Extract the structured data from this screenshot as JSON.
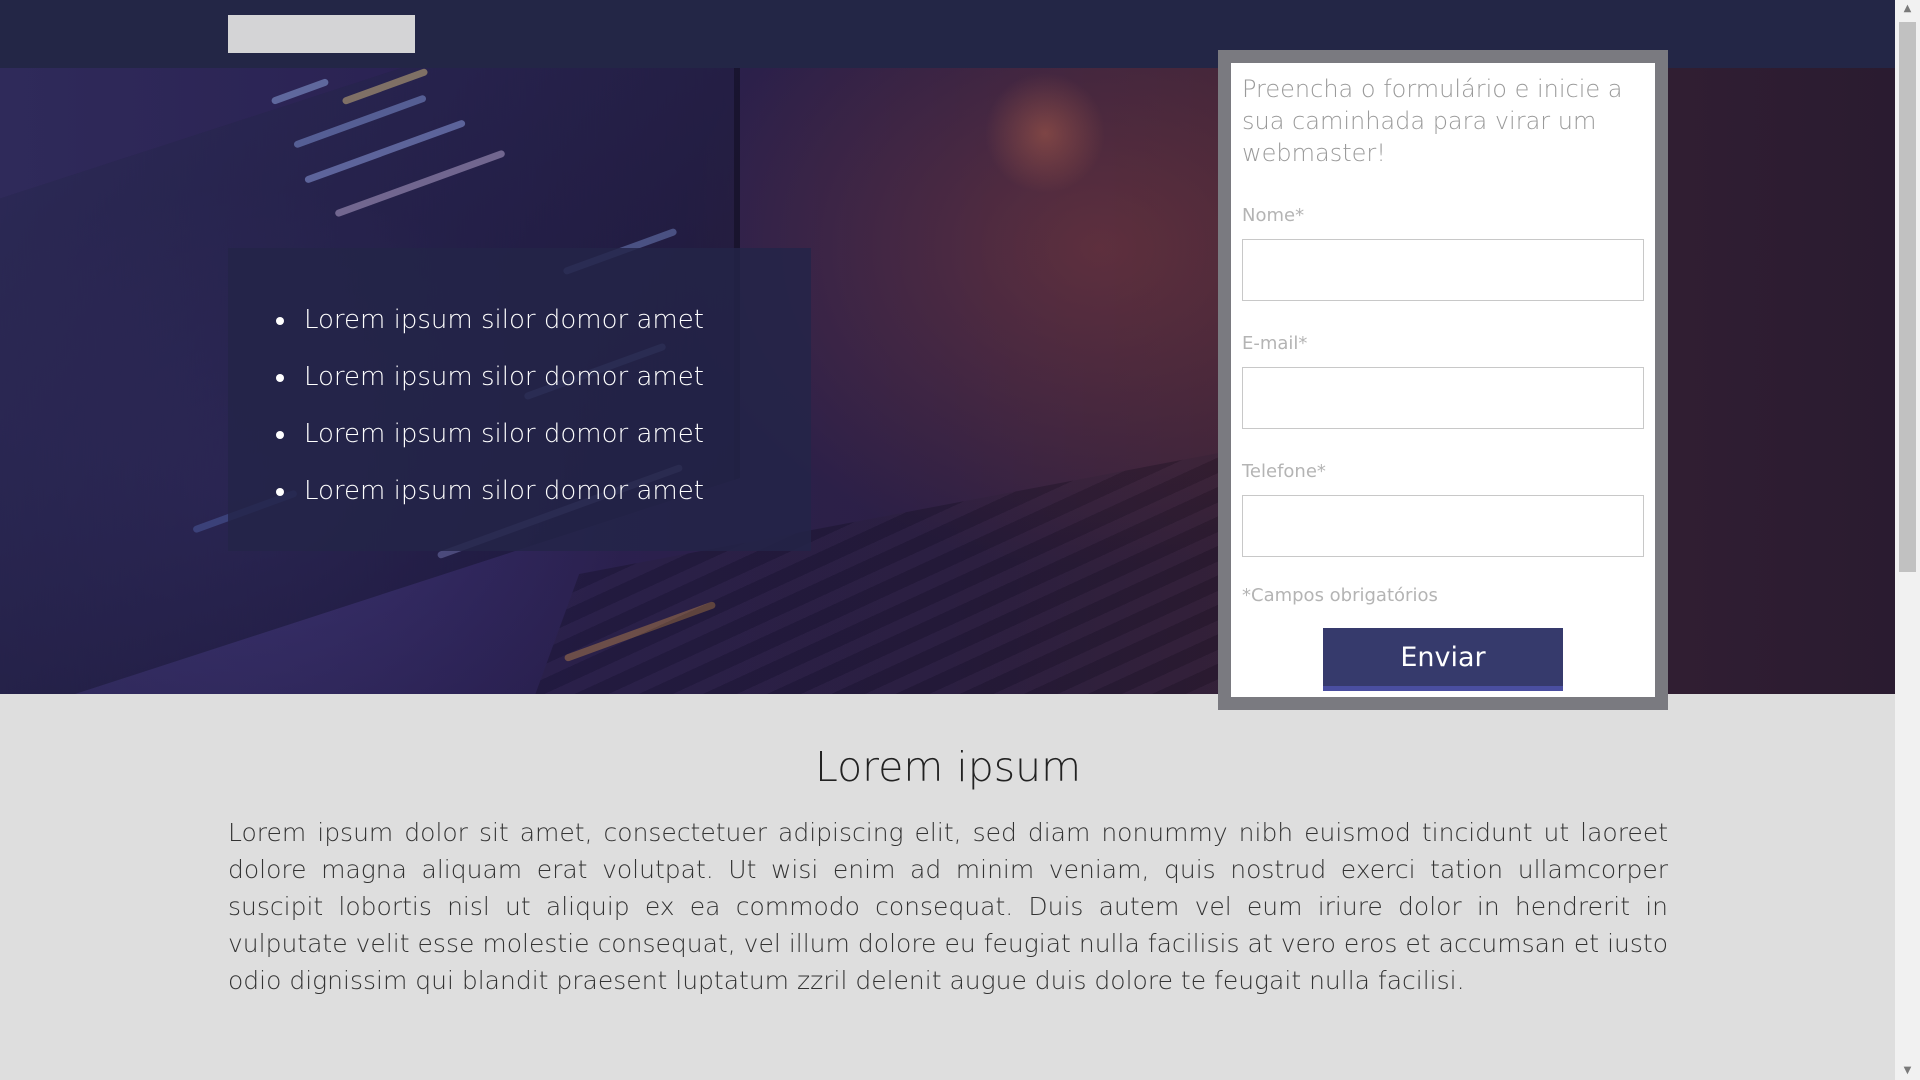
{
  "header": {
    "logo": ""
  },
  "hero": {
    "features": [
      "Lorem ipsum silor domor amet",
      "Lorem ipsum silor domor amet",
      "Lorem ipsum silor domor amet",
      "Lorem ipsum silor domor amet"
    ]
  },
  "form": {
    "title": "Preencha o formulário e inicie a sua caminhada para virar um webmaster!",
    "fields": [
      {
        "label": "Nome*",
        "value": "",
        "placeholder": ""
      },
      {
        "label": "E-mail*",
        "value": "",
        "placeholder": ""
      },
      {
        "label": "Telefone*",
        "value": "",
        "placeholder": ""
      }
    ],
    "required_note": "*Campos obrigatórios",
    "submit_label": "Enviar"
  },
  "content": {
    "heading": "Lorem ipsum",
    "paragraph": "Lorem ipsum dolor sit amet, consectetuer adipiscing elit, sed diam nonummy nibh euismod tincidunt ut laoreet dolore magna aliquam erat volutpat. Ut wisi enim ad minim veniam, quis nostrud exerci tation ullamcorper suscipit lobortis nisl ut aliquip ex ea commodo consequat. Duis autem vel eum iriure dolor in hendrerit in vulputate velit esse molestie consequat, vel illum dolore eu feugiat nulla facilisis at vero eros et accumsan et iusto odio dignissim qui blandit praesent luptatum zzril delenit augue duis dolore te feugait nulla facilisi."
  },
  "colors": {
    "header_bg": "#232646",
    "button_bg": "#363a6c",
    "page_bg": "#dedede"
  },
  "icons": {
    "scroll_up": "scroll-up-arrow-icon",
    "scroll_down": "scroll-down-arrow-icon"
  }
}
